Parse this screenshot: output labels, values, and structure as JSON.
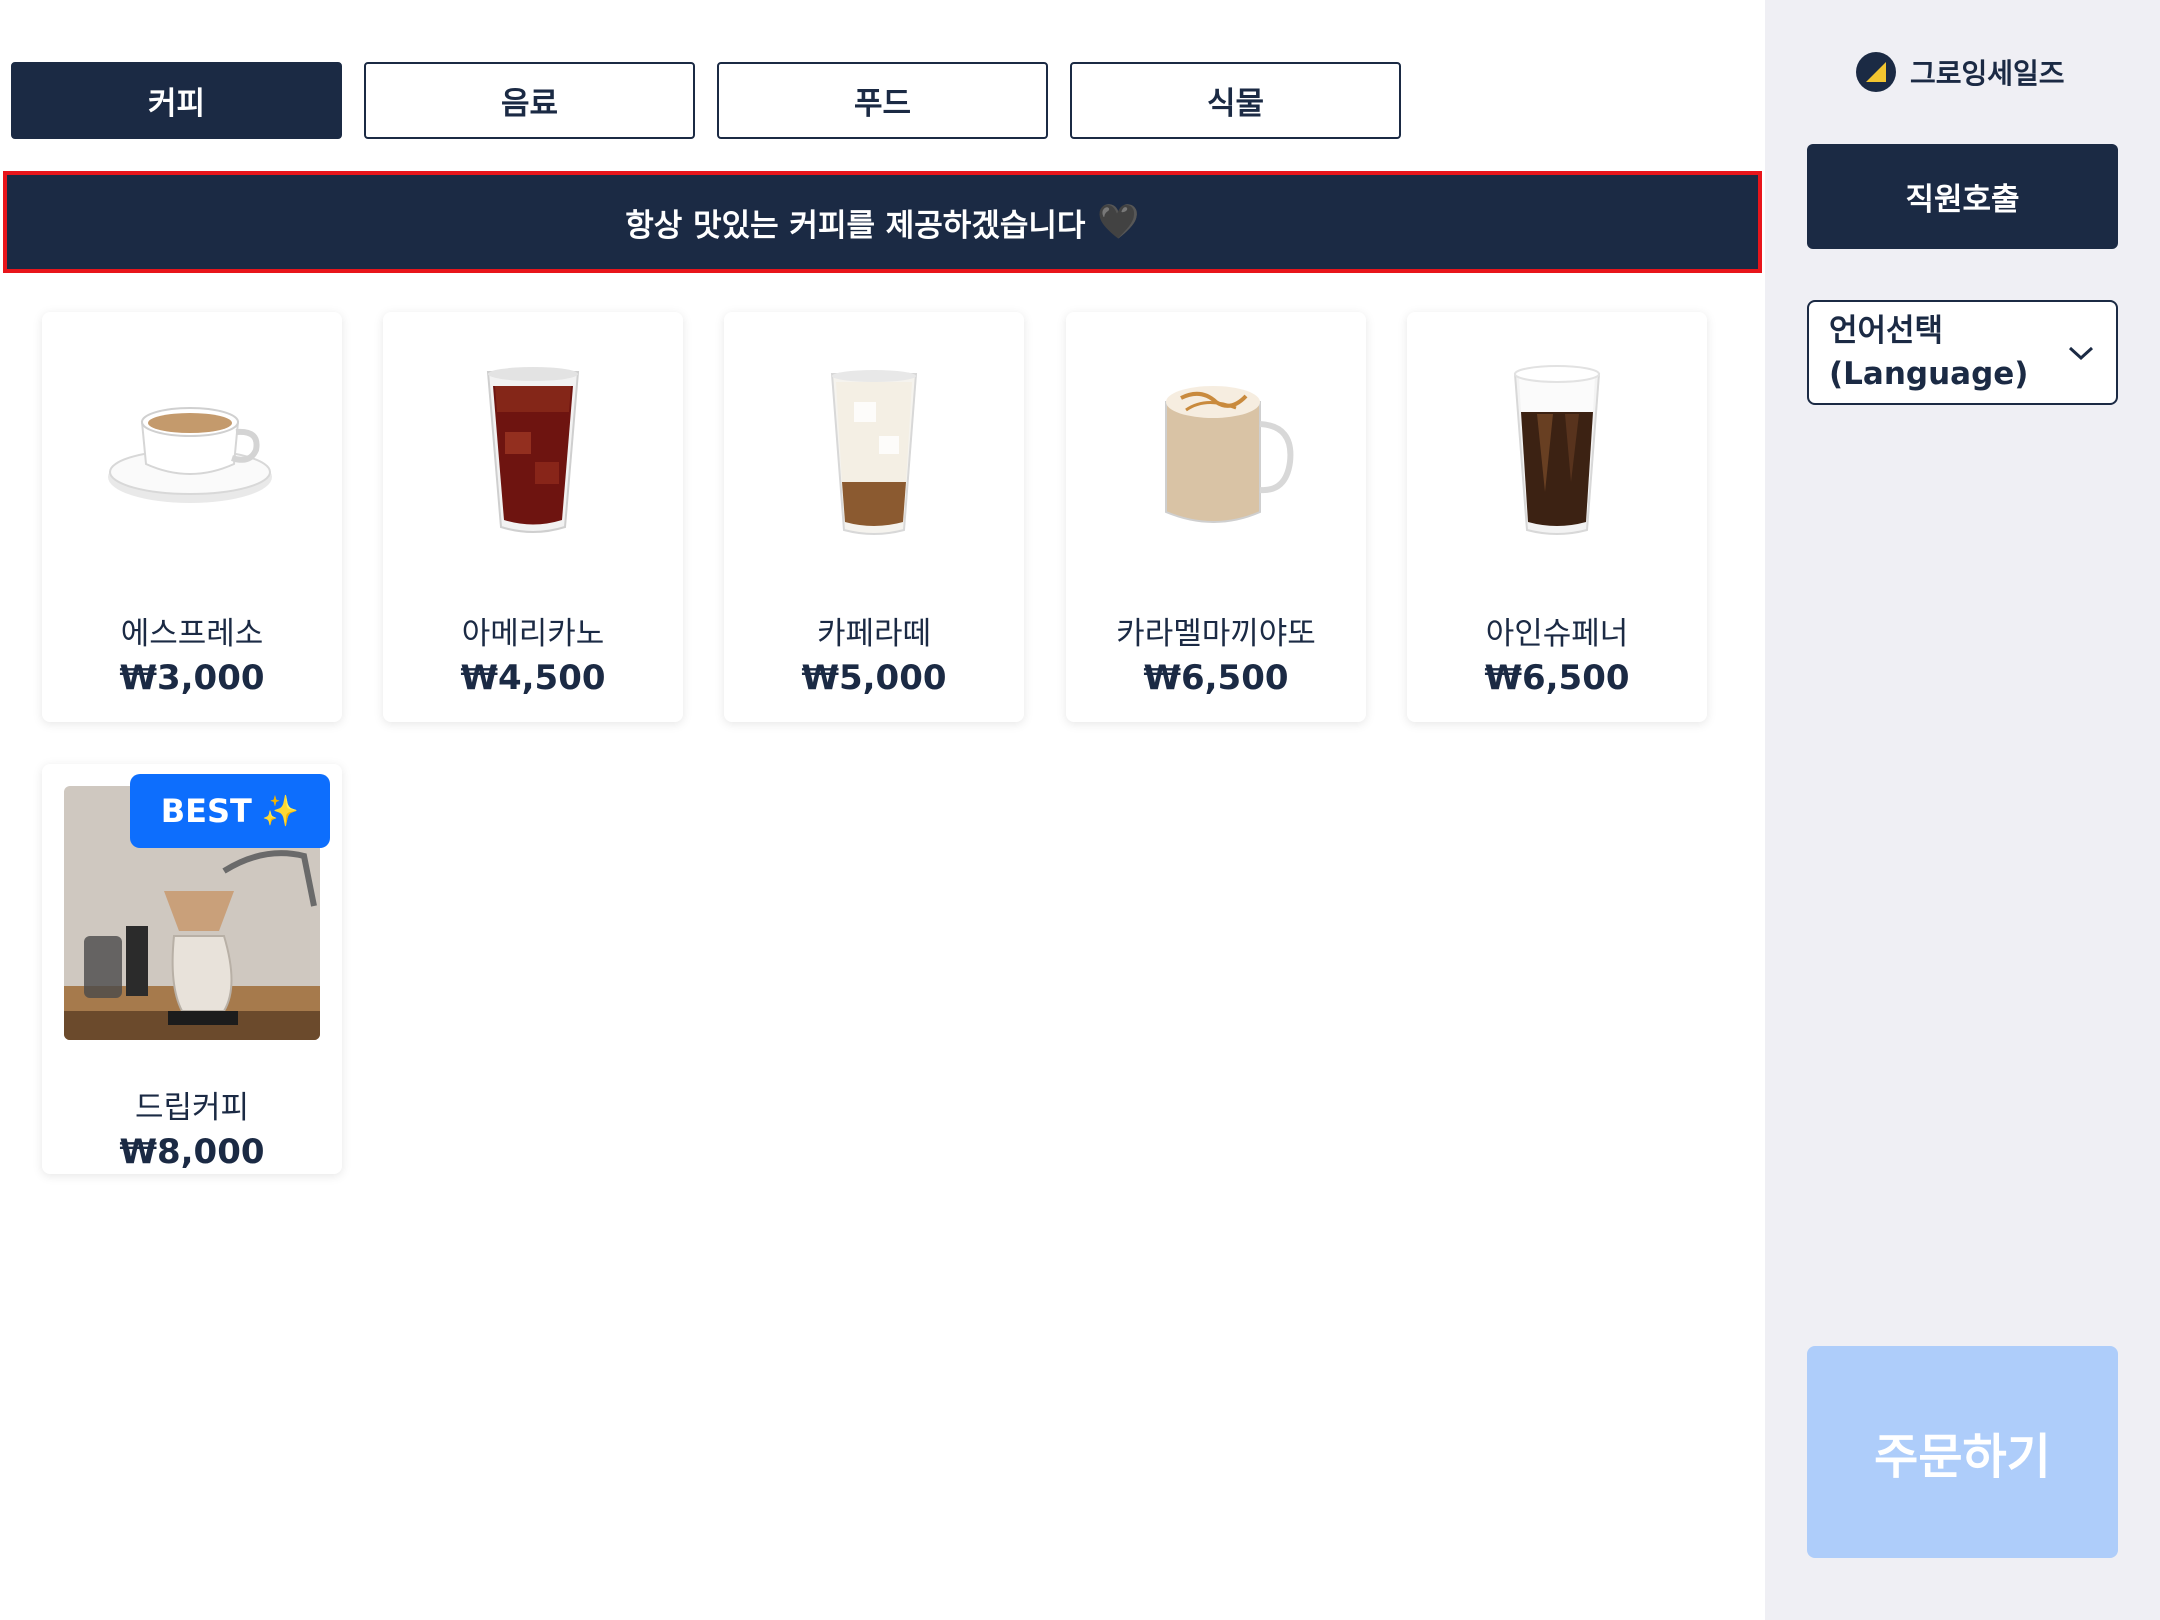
{
  "tabs": [
    {
      "label": "커피",
      "active": true
    },
    {
      "label": "음료",
      "active": false
    },
    {
      "label": "푸드",
      "active": false
    },
    {
      "label": "식물",
      "active": false
    }
  ],
  "banner": {
    "text": "항상 맛있는 커피를 제공하겠습니다",
    "icon": "black-heart-icon"
  },
  "products": [
    {
      "name": "에스프레소",
      "price": "₩3,000",
      "icon": "espresso-cup"
    },
    {
      "name": "아메리카노",
      "price": "₩4,500",
      "icon": "iced-americano"
    },
    {
      "name": "카페라떼",
      "price": "₩5,000",
      "icon": "iced-latte"
    },
    {
      "name": "카라멜마끼야또",
      "price": "₩6,500",
      "icon": "caramel-macchiato-mug"
    },
    {
      "name": "아인슈페너",
      "price": "₩6,500",
      "icon": "einspanner-glass"
    },
    {
      "name": "드립커피",
      "price": "₩8,000",
      "icon": "drip-coffee-photo",
      "badge": "BEST"
    }
  ],
  "sidebar": {
    "brand": "그로잉세일즈",
    "staff_call": "직원호출",
    "language_line1": "언어선택",
    "language_line2": "(Language)",
    "order": "주문하기"
  },
  "colors": {
    "navy": "#1b2a44",
    "highlight_border": "#e8151b",
    "best_badge": "#0d6efd",
    "order_disabled": "#aecdfa",
    "sidebar_bg": "#efeff4"
  }
}
